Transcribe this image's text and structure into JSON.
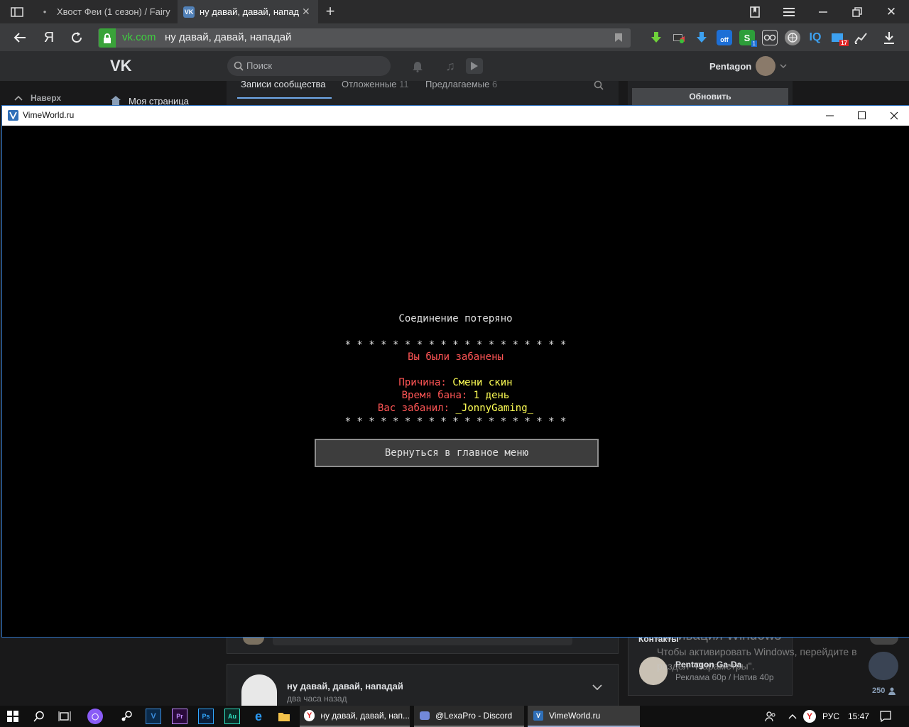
{
  "browser": {
    "tabs": [
      {
        "label": "Хвост Феи (1 сезон) / Fairy",
        "active": false
      },
      {
        "label": "ну давай, давай, нападай",
        "active": true
      }
    ],
    "address": {
      "domain": "vk.com",
      "title": "ну давай, давай, нападай"
    },
    "extension_badges": {
      "offline": "off",
      "s_count": "1",
      "mail_count": "17"
    }
  },
  "vk": {
    "search_placeholder": "Поиск",
    "user_name": "Pentagon",
    "nav_up": "Наверх",
    "nav_my_page": "Моя страница",
    "tabs": [
      {
        "label": "Записи сообщества",
        "count": ""
      },
      {
        "label": "Отложенные",
        "count": "11"
      },
      {
        "label": "Предлагаемые",
        "count": "6"
      }
    ],
    "refresh_button": "Обновить",
    "post": {
      "author": "ну давай, давай, нападай",
      "time": "два часа назад"
    },
    "contacts_title": "Контакты",
    "contact": {
      "name": "Pentagon Ga-Da",
      "role": "Реклама 60р / Натив 40р"
    },
    "online_count": "250"
  },
  "game_window": {
    "title": "VimeWorld.ru",
    "connection_lost": "Соединение потеряно",
    "stars": "* * * * * * * * * * * * * * * * * * *",
    "banned": "Вы были забанены",
    "reason_label": "Причина:",
    "reason_value": "Смени скин",
    "duration_label": "Время бана:",
    "duration_value": "1 день",
    "banned_by_label": "Вас забанил:",
    "banned_by_value": "_JonnyGaming_",
    "back_button": "Вернуться в главное меню"
  },
  "watermark": {
    "title": "Активация Windows",
    "text1": "Чтобы активировать Windows, перейдите в",
    "text2": "раздел \"Параметры\"."
  },
  "taskbar": {
    "apps": [
      {
        "label": "ну давай, давай, нап...",
        "active": false
      },
      {
        "label": "@LexaPro - Discord",
        "active": false
      },
      {
        "label": "VimeWorld.ru",
        "active": true
      }
    ],
    "language": "РУС",
    "time": "15:47"
  },
  "colors": {
    "ban_red": "#ff5555",
    "ban_yellow": "#ffff55",
    "vk_blue": "#5181b8",
    "secure_green": "#3aa33a"
  }
}
